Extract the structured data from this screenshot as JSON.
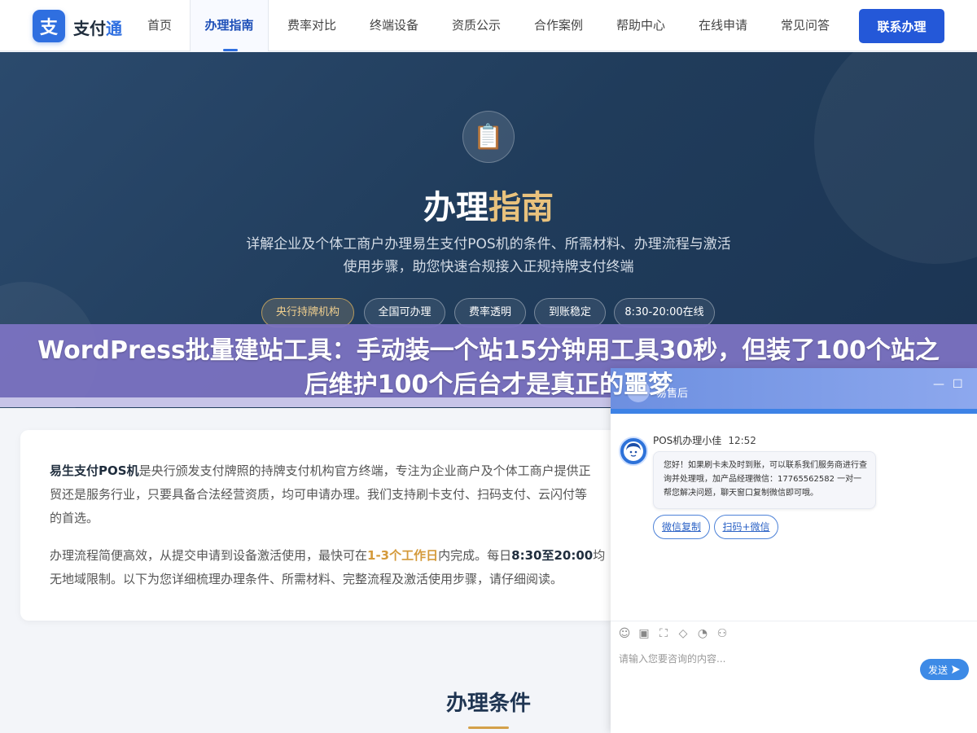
{
  "nav": {
    "logo_char": "支",
    "logo_text_main": "支付",
    "logo_text_accent": "通",
    "items": [
      {
        "label": "首页"
      },
      {
        "label": "办理指南"
      },
      {
        "label": "费率对比"
      },
      {
        "label": "终端设备"
      },
      {
        "label": "资质公示"
      },
      {
        "label": "合作案例"
      },
      {
        "label": "帮助中心"
      },
      {
        "label": "在线申请"
      },
      {
        "label": "常见问答"
      }
    ],
    "active_item": "办理指南",
    "contact_button": "联系办理"
  },
  "hero": {
    "icon": "📋",
    "title_main": "办理",
    "title_accent": "指南",
    "desc_line1": "详解企业及个体工商户办理易生支付POS机的条件、所需材料、办理流程与激活",
    "desc_line2": "使用步骤，助您快速合规接入正规持牌支付终端",
    "tags": [
      "央行持牌机构",
      "全国可办理",
      "费率透明",
      "到账稳定",
      "8:30-20:00在线"
    ]
  },
  "banner": {
    "title": "WordPress批量建站工具：手动装一个站15分钟用工具30秒，但装了100个站之后维护100个后台才是真正的噩梦"
  },
  "intro": {
    "p1_brand": "易生支付POS机",
    "p1_text": "是央行颁发支付牌照的持牌支付机构官方终端，专注为企业商户及个体工商户提供正",
    "p1_line2": "贸还是服务行业，只要具备合法经营资质，均可申请办理。我们支持刷卡支付、扫码支付、云闪付等",
    "p1_line3": "的首选。",
    "p2_a": "办理流程简便高效，从提交申请到设备激活使用，最快可在",
    "p2_hl": "1-3个工作日",
    "p2_b": "内完成。每日",
    "p2_time": "8:30至20:00",
    "p2_c": "均",
    "p2_line2": "无地域限制。以下为您详细梳理办理条件、所需材料、完整流程及激活使用步骤，请仔细阅读。"
  },
  "section": {
    "title": "办理条件"
  },
  "chat": {
    "header_title": "易售后",
    "agent_name": "POS机办理小佳",
    "agent_time": "12:52",
    "message": "您好！如果刷卡未及时到账，可以联系我们服务商进行查询并处理哦，加产品经理微信：17765562582 一对一帮您解决问题，聊天窗口复制微信即可哦。",
    "chips": [
      "微信复制",
      "扫码+微信"
    ],
    "input_placeholder": "请输入您要咨询的内容...",
    "send_label": "发送",
    "toolbar_icons": [
      "emoji-icon",
      "image-icon",
      "screenshot-icon",
      "shield-icon",
      "rating-icon",
      "chat-bubbles-icon"
    ]
  },
  "colors": {
    "brand_blue": "#2458d8",
    "hero_bg": "#203c5b",
    "gold": "#e9c27d",
    "banner_purple": "#7d73c3"
  }
}
